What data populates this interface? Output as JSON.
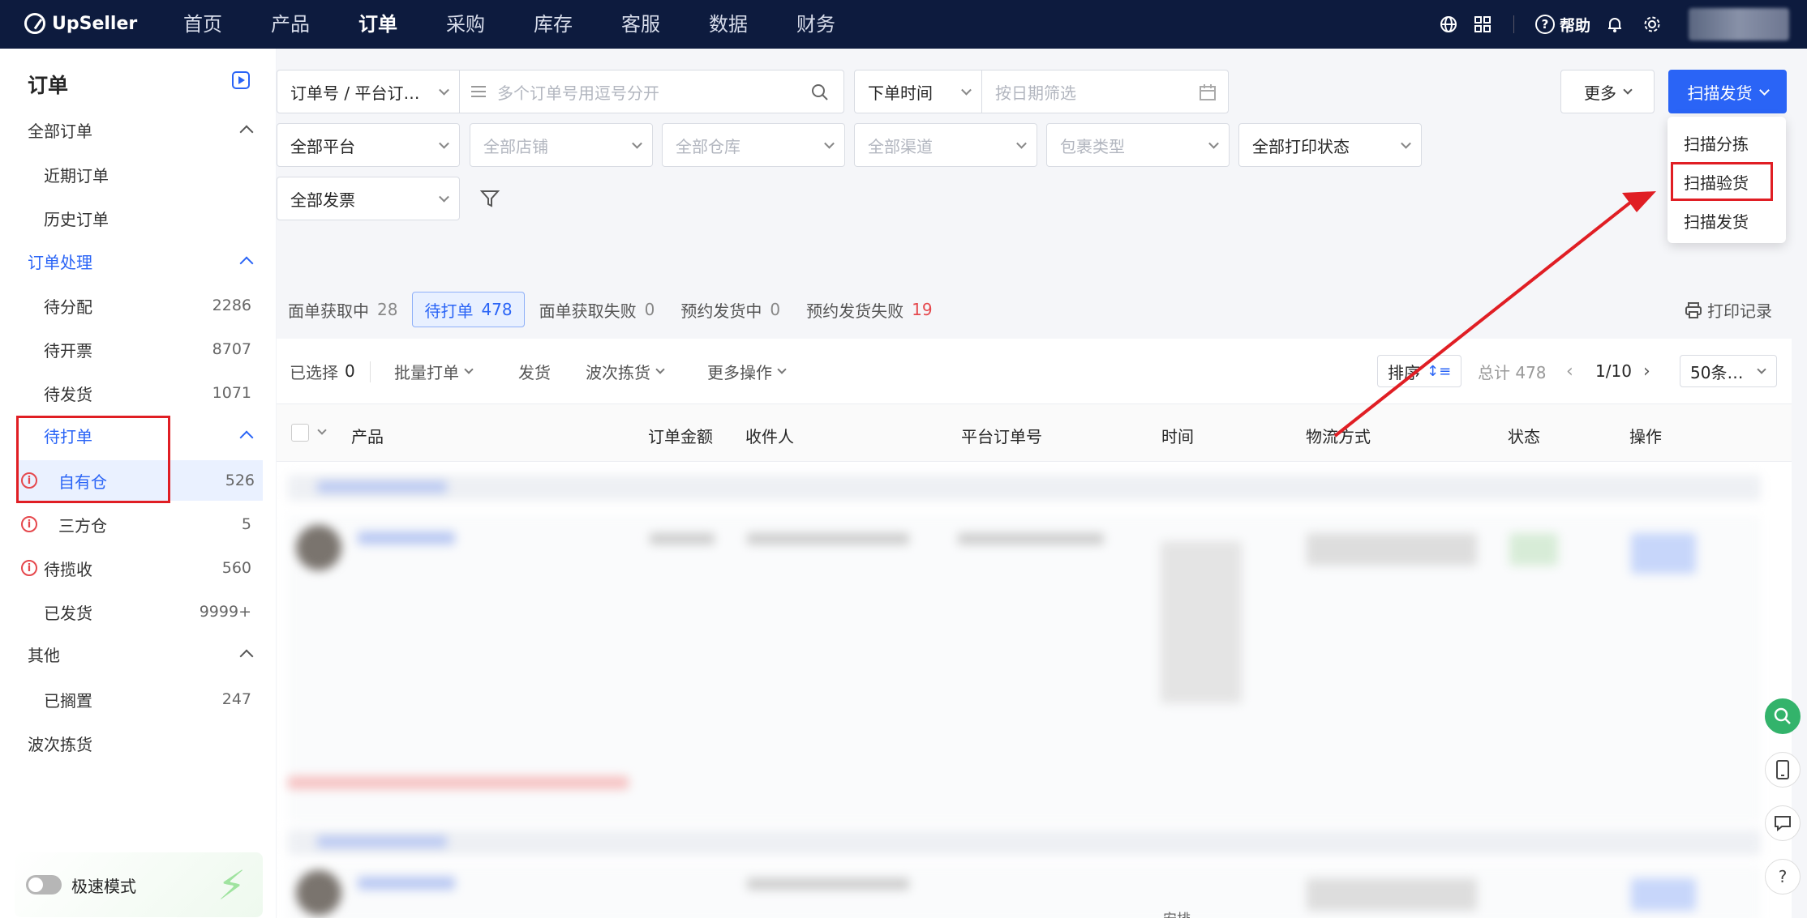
{
  "app": {
    "brand": "UpSeller"
  },
  "nav": [
    "首页",
    "产品",
    "订单",
    "采购",
    "库存",
    "客服",
    "数据",
    "财务"
  ],
  "top": {
    "help": "帮助"
  },
  "sidebar": {
    "title": "订单",
    "all_orders": "全部订单",
    "recent": "近期订单",
    "history": "历史订单",
    "processing": "订单处理",
    "to_assign": {
      "label": "待分配",
      "count": "2286"
    },
    "to_invoice": {
      "label": "待开票",
      "count": "8707"
    },
    "to_ship": {
      "label": "待发货",
      "count": "1071"
    },
    "to_print": "待打单",
    "own_warehouse": {
      "label": "自有仓",
      "count": "526"
    },
    "third_warehouse": {
      "label": "三方仓",
      "count": "5"
    },
    "to_collect": {
      "label": "待揽收",
      "count": "560"
    },
    "shipped": {
      "label": "已发货",
      "count": "9999+"
    },
    "other": "其他",
    "shelved": {
      "label": "已搁置",
      "count": "247"
    },
    "wave": "波次拣货",
    "speed_mode": "极速模式"
  },
  "filters": {
    "order_field": "订单号 / 平台订…",
    "order_placeholder": "多个订单号用逗号分开",
    "time_field": "下单时间",
    "date_placeholder": "按日期筛选",
    "more": "更多",
    "scan_ship": "扫描发货",
    "platform": "全部平台",
    "store": "全部店铺",
    "warehouse": "全部仓库",
    "channel": "全部渠道",
    "package": "包裹类型",
    "print_status": "全部打印状态",
    "invoice": "全部发票"
  },
  "scan_menu": [
    "扫描分拣",
    "扫描验货",
    "扫描发货"
  ],
  "tabs": [
    {
      "label": "面单获取中",
      "count": "28"
    },
    {
      "label": "待打单",
      "count": "478"
    },
    {
      "label": "面单获取失败",
      "count": "0"
    },
    {
      "label": "预约发货中",
      "count": "0"
    },
    {
      "label": "预约发货失败",
      "count": "19"
    }
  ],
  "print_record": "打印记录",
  "toolbar": {
    "selected_label": "已选择",
    "selected_count": "0",
    "batch_print": "批量打单",
    "ship": "发货",
    "wave_pick": "波次拣货",
    "more_ops": "更多操作",
    "sort": "排序",
    "total": "总计 478",
    "page": "1/10",
    "page_size": "50条…"
  },
  "columns": [
    "产品",
    "订单金额",
    "收件人",
    "平台订单号",
    "时间",
    "物流方式",
    "状态",
    "操作"
  ],
  "partial_text": "安排"
}
